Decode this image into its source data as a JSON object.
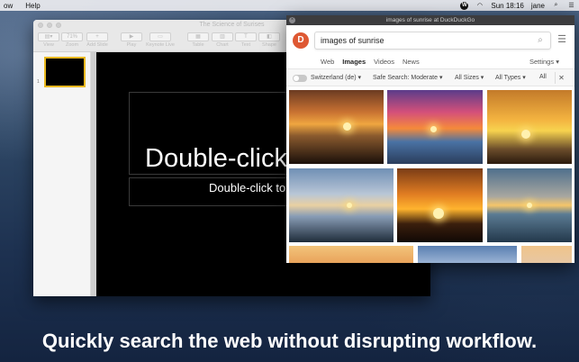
{
  "menubar": {
    "left_items": [
      "ow",
      "Help"
    ],
    "clock": "Sun 18:16",
    "user": "jane"
  },
  "keynote": {
    "window_title": "The Science of Surises",
    "toolbar": [
      {
        "label": "View",
        "icon": "view-icon"
      },
      {
        "label": "Zoom",
        "value": "71%"
      },
      {
        "label": "Add Slide",
        "icon": "add-slide-icon"
      },
      {
        "label": "Play",
        "icon": "play-icon"
      },
      {
        "label": "Keynote Live",
        "icon": "keynote-live-icon"
      },
      {
        "label": "Table",
        "icon": "table-icon"
      },
      {
        "label": "Chart",
        "icon": "chart-icon"
      },
      {
        "label": "Text",
        "icon": "text-icon"
      },
      {
        "label": "Shape",
        "icon": "shape-icon"
      }
    ],
    "slide_number": "1",
    "slide_title": "Double-click",
    "slide_subtitle": "Double-click to"
  },
  "ddg": {
    "window_title": "images of sunrise at DuckDuckGo",
    "logo_letter": "D",
    "query": "images of sunrise",
    "tabs": [
      {
        "label": "Web",
        "active": false
      },
      {
        "label": "Images",
        "active": true
      },
      {
        "label": "Videos",
        "active": false
      },
      {
        "label": "News",
        "active": false
      }
    ],
    "settings_label": "Settings",
    "filters": {
      "region": "Switzerland (de)",
      "safe_search": "Safe Search: Moderate",
      "sizes": "All Sizes",
      "types": "All Types",
      "more": "All"
    },
    "accent_color": "#de5833"
  },
  "caption": "Quickly search the web without disrupting workflow."
}
